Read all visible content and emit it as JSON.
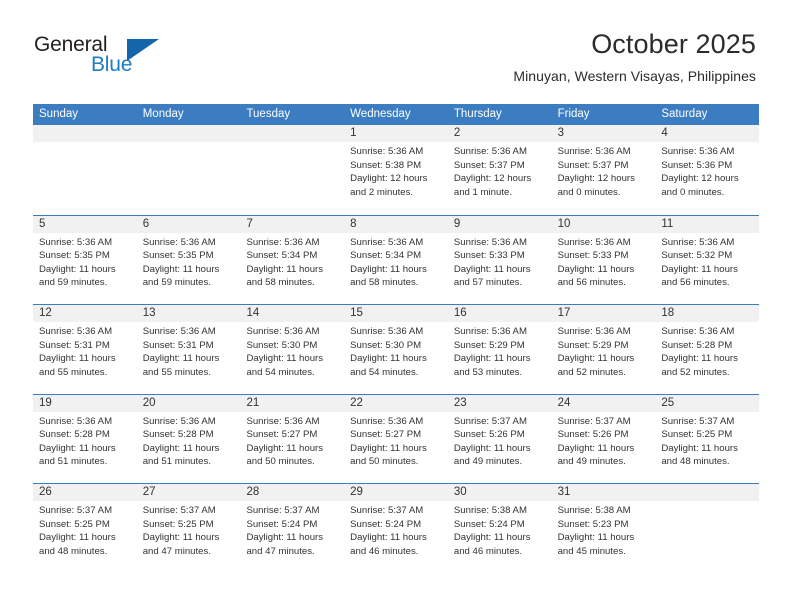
{
  "brand": {
    "name_part1": "General",
    "name_part2": "Blue",
    "accent_color": "#1565ab",
    "blue_text_color": "#1f7cc4"
  },
  "header": {
    "title": "October 2025",
    "subtitle": "Minuyan, Western Visayas, Philippines"
  },
  "theme": {
    "header_bar_color": "#3b7dc0",
    "date_band_color": "#f1f1f1",
    "text_color": "#333333"
  },
  "weekdays": [
    "Sunday",
    "Monday",
    "Tuesday",
    "Wednesday",
    "Thursday",
    "Friday",
    "Saturday"
  ],
  "weeks": [
    [
      {
        "empty": true
      },
      {
        "empty": true
      },
      {
        "empty": true
      },
      {
        "day": "1",
        "sunrise": "Sunrise: 5:36 AM",
        "sunset": "Sunset: 5:38 PM",
        "daylight1": "Daylight: 12 hours",
        "daylight2": "and 2 minutes."
      },
      {
        "day": "2",
        "sunrise": "Sunrise: 5:36 AM",
        "sunset": "Sunset: 5:37 PM",
        "daylight1": "Daylight: 12 hours",
        "daylight2": "and 1 minute."
      },
      {
        "day": "3",
        "sunrise": "Sunrise: 5:36 AM",
        "sunset": "Sunset: 5:37 PM",
        "daylight1": "Daylight: 12 hours",
        "daylight2": "and 0 minutes."
      },
      {
        "day": "4",
        "sunrise": "Sunrise: 5:36 AM",
        "sunset": "Sunset: 5:36 PM",
        "daylight1": "Daylight: 12 hours",
        "daylight2": "and 0 minutes."
      }
    ],
    [
      {
        "day": "5",
        "sunrise": "Sunrise: 5:36 AM",
        "sunset": "Sunset: 5:35 PM",
        "daylight1": "Daylight: 11 hours",
        "daylight2": "and 59 minutes."
      },
      {
        "day": "6",
        "sunrise": "Sunrise: 5:36 AM",
        "sunset": "Sunset: 5:35 PM",
        "daylight1": "Daylight: 11 hours",
        "daylight2": "and 59 minutes."
      },
      {
        "day": "7",
        "sunrise": "Sunrise: 5:36 AM",
        "sunset": "Sunset: 5:34 PM",
        "daylight1": "Daylight: 11 hours",
        "daylight2": "and 58 minutes."
      },
      {
        "day": "8",
        "sunrise": "Sunrise: 5:36 AM",
        "sunset": "Sunset: 5:34 PM",
        "daylight1": "Daylight: 11 hours",
        "daylight2": "and 58 minutes."
      },
      {
        "day": "9",
        "sunrise": "Sunrise: 5:36 AM",
        "sunset": "Sunset: 5:33 PM",
        "daylight1": "Daylight: 11 hours",
        "daylight2": "and 57 minutes."
      },
      {
        "day": "10",
        "sunrise": "Sunrise: 5:36 AM",
        "sunset": "Sunset: 5:33 PM",
        "daylight1": "Daylight: 11 hours",
        "daylight2": "and 56 minutes."
      },
      {
        "day": "11",
        "sunrise": "Sunrise: 5:36 AM",
        "sunset": "Sunset: 5:32 PM",
        "daylight1": "Daylight: 11 hours",
        "daylight2": "and 56 minutes."
      }
    ],
    [
      {
        "day": "12",
        "sunrise": "Sunrise: 5:36 AM",
        "sunset": "Sunset: 5:31 PM",
        "daylight1": "Daylight: 11 hours",
        "daylight2": "and 55 minutes."
      },
      {
        "day": "13",
        "sunrise": "Sunrise: 5:36 AM",
        "sunset": "Sunset: 5:31 PM",
        "daylight1": "Daylight: 11 hours",
        "daylight2": "and 55 minutes."
      },
      {
        "day": "14",
        "sunrise": "Sunrise: 5:36 AM",
        "sunset": "Sunset: 5:30 PM",
        "daylight1": "Daylight: 11 hours",
        "daylight2": "and 54 minutes."
      },
      {
        "day": "15",
        "sunrise": "Sunrise: 5:36 AM",
        "sunset": "Sunset: 5:30 PM",
        "daylight1": "Daylight: 11 hours",
        "daylight2": "and 54 minutes."
      },
      {
        "day": "16",
        "sunrise": "Sunrise: 5:36 AM",
        "sunset": "Sunset: 5:29 PM",
        "daylight1": "Daylight: 11 hours",
        "daylight2": "and 53 minutes."
      },
      {
        "day": "17",
        "sunrise": "Sunrise: 5:36 AM",
        "sunset": "Sunset: 5:29 PM",
        "daylight1": "Daylight: 11 hours",
        "daylight2": "and 52 minutes."
      },
      {
        "day": "18",
        "sunrise": "Sunrise: 5:36 AM",
        "sunset": "Sunset: 5:28 PM",
        "daylight1": "Daylight: 11 hours",
        "daylight2": "and 52 minutes."
      }
    ],
    [
      {
        "day": "19",
        "sunrise": "Sunrise: 5:36 AM",
        "sunset": "Sunset: 5:28 PM",
        "daylight1": "Daylight: 11 hours",
        "daylight2": "and 51 minutes."
      },
      {
        "day": "20",
        "sunrise": "Sunrise: 5:36 AM",
        "sunset": "Sunset: 5:28 PM",
        "daylight1": "Daylight: 11 hours",
        "daylight2": "and 51 minutes."
      },
      {
        "day": "21",
        "sunrise": "Sunrise: 5:36 AM",
        "sunset": "Sunset: 5:27 PM",
        "daylight1": "Daylight: 11 hours",
        "daylight2": "and 50 minutes."
      },
      {
        "day": "22",
        "sunrise": "Sunrise: 5:36 AM",
        "sunset": "Sunset: 5:27 PM",
        "daylight1": "Daylight: 11 hours",
        "daylight2": "and 50 minutes."
      },
      {
        "day": "23",
        "sunrise": "Sunrise: 5:37 AM",
        "sunset": "Sunset: 5:26 PM",
        "daylight1": "Daylight: 11 hours",
        "daylight2": "and 49 minutes."
      },
      {
        "day": "24",
        "sunrise": "Sunrise: 5:37 AM",
        "sunset": "Sunset: 5:26 PM",
        "daylight1": "Daylight: 11 hours",
        "daylight2": "and 49 minutes."
      },
      {
        "day": "25",
        "sunrise": "Sunrise: 5:37 AM",
        "sunset": "Sunset: 5:25 PM",
        "daylight1": "Daylight: 11 hours",
        "daylight2": "and 48 minutes."
      }
    ],
    [
      {
        "day": "26",
        "sunrise": "Sunrise: 5:37 AM",
        "sunset": "Sunset: 5:25 PM",
        "daylight1": "Daylight: 11 hours",
        "daylight2": "and 48 minutes."
      },
      {
        "day": "27",
        "sunrise": "Sunrise: 5:37 AM",
        "sunset": "Sunset: 5:25 PM",
        "daylight1": "Daylight: 11 hours",
        "daylight2": "and 47 minutes."
      },
      {
        "day": "28",
        "sunrise": "Sunrise: 5:37 AM",
        "sunset": "Sunset: 5:24 PM",
        "daylight1": "Daylight: 11 hours",
        "daylight2": "and 47 minutes."
      },
      {
        "day": "29",
        "sunrise": "Sunrise: 5:37 AM",
        "sunset": "Sunset: 5:24 PM",
        "daylight1": "Daylight: 11 hours",
        "daylight2": "and 46 minutes."
      },
      {
        "day": "30",
        "sunrise": "Sunrise: 5:38 AM",
        "sunset": "Sunset: 5:24 PM",
        "daylight1": "Daylight: 11 hours",
        "daylight2": "and 46 minutes."
      },
      {
        "day": "31",
        "sunrise": "Sunrise: 5:38 AM",
        "sunset": "Sunset: 5:23 PM",
        "daylight1": "Daylight: 11 hours",
        "daylight2": "and 45 minutes."
      },
      {
        "empty": true
      }
    ]
  ]
}
